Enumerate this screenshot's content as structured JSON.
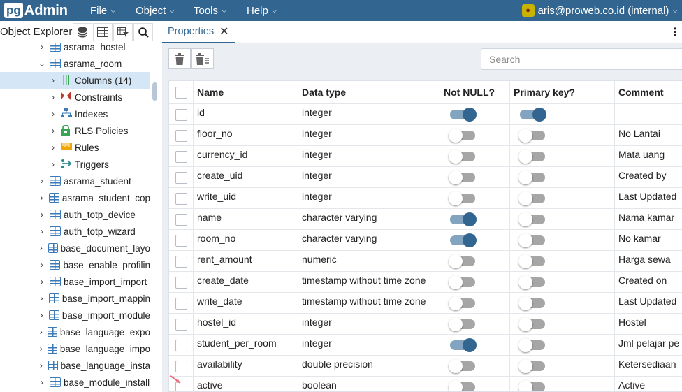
{
  "navbar": {
    "logo_pg": "pg",
    "logo_admin": "Admin",
    "menus": [
      "File",
      "Object",
      "Tools",
      "Help"
    ],
    "user": "aris@proweb.co.id (internal)",
    "bg_color": "#326690"
  },
  "object_explorer": {
    "title": "Object Explorer",
    "buttons": [
      "database-icon",
      "table-grid-icon",
      "filtered-rows-icon",
      "search-icon"
    ]
  },
  "tree": [
    {
      "label": "asrama_hostel",
      "arrow": "›",
      "icon": "table-icon",
      "level": 1
    },
    {
      "label": "asrama_room",
      "arrow": "⌄",
      "icon": "table-icon",
      "level": 1
    },
    {
      "label": "Columns",
      "count": "(14)",
      "arrow": "›",
      "icon": "columns-icon",
      "level": 2,
      "selected": true
    },
    {
      "label": "Constraints",
      "arrow": "›",
      "icon": "constraints-icon",
      "level": 2
    },
    {
      "label": "Indexes",
      "arrow": "›",
      "icon": "indexes-icon",
      "level": 2
    },
    {
      "label": "RLS Policies",
      "arrow": "›",
      "icon": "rls-lock-icon",
      "level": 2
    },
    {
      "label": "Rules",
      "arrow": "›",
      "icon": "rules-icon",
      "level": 2
    },
    {
      "label": "Triggers",
      "arrow": "›",
      "icon": "triggers-icon",
      "level": 2
    },
    {
      "label": "asrama_student",
      "arrow": "›",
      "icon": "table-icon",
      "level": 1
    },
    {
      "label": "asrama_student_cop",
      "arrow": "›",
      "icon": "table-icon",
      "level": 1
    },
    {
      "label": "auth_totp_device",
      "arrow": "›",
      "icon": "table-icon",
      "level": 1
    },
    {
      "label": "auth_totp_wizard",
      "arrow": "›",
      "icon": "table-icon",
      "level": 1
    },
    {
      "label": "base_document_layo",
      "arrow": "›",
      "icon": "table-icon",
      "level": 1
    },
    {
      "label": "base_enable_profilin",
      "arrow": "›",
      "icon": "table-icon",
      "level": 1
    },
    {
      "label": "base_import_import",
      "arrow": "›",
      "icon": "table-icon",
      "level": 1
    },
    {
      "label": "base_import_mappin",
      "arrow": "›",
      "icon": "table-icon",
      "level": 1
    },
    {
      "label": "base_import_module",
      "arrow": "›",
      "icon": "table-icon",
      "level": 1
    },
    {
      "label": "base_language_expo",
      "arrow": "›",
      "icon": "table-icon",
      "level": 1
    },
    {
      "label": "base_language_impo",
      "arrow": "›",
      "icon": "table-icon",
      "level": 1
    },
    {
      "label": "base_language_insta",
      "arrow": "›",
      "icon": "table-icon",
      "level": 1
    },
    {
      "label": "base_module_install",
      "arrow": "›",
      "icon": "table-icon",
      "level": 1
    }
  ],
  "tabs": {
    "properties_label": "Properties",
    "close": "✕",
    "more": "⋮"
  },
  "toolbar": {
    "delete_icon": "trash-icon",
    "delete_all_icon": "trash-list-icon",
    "search_placeholder": "Search"
  },
  "table": {
    "headers": {
      "name": "Name",
      "type": "Data type",
      "not_null": "Not NULL?",
      "pk": "Primary key?",
      "comment": "Comment"
    },
    "rows": [
      {
        "name": "id",
        "type": "integer",
        "not_null": true,
        "pk": true,
        "comment": ""
      },
      {
        "name": "floor_no",
        "type": "integer",
        "not_null": false,
        "pk": false,
        "comment": "No Lantai"
      },
      {
        "name": "currency_id",
        "type": "integer",
        "not_null": false,
        "pk": false,
        "comment": "Mata uang"
      },
      {
        "name": "create_uid",
        "type": "integer",
        "not_null": false,
        "pk": false,
        "comment": "Created by"
      },
      {
        "name": "write_uid",
        "type": "integer",
        "not_null": false,
        "pk": false,
        "comment": "Last Updated"
      },
      {
        "name": "name",
        "type": "character varying",
        "not_null": true,
        "pk": false,
        "comment": "Nama kamar"
      },
      {
        "name": "room_no",
        "type": "character varying",
        "not_null": true,
        "pk": false,
        "comment": "No kamar"
      },
      {
        "name": "rent_amount",
        "type": "numeric",
        "not_null": false,
        "pk": false,
        "comment": "Harga sewa"
      },
      {
        "name": "create_date",
        "type": "timestamp without time zone",
        "not_null": false,
        "pk": false,
        "comment": "Created on"
      },
      {
        "name": "write_date",
        "type": "timestamp without time zone",
        "not_null": false,
        "pk": false,
        "comment": "Last Updated"
      },
      {
        "name": "hostel_id",
        "type": "integer",
        "not_null": false,
        "pk": false,
        "comment": "Hostel"
      },
      {
        "name": "student_per_room",
        "type": "integer",
        "not_null": true,
        "pk": false,
        "comment": "Jml pelajar pe"
      },
      {
        "name": "availability",
        "type": "double precision",
        "not_null": false,
        "pk": false,
        "comment": "Ketersediaan"
      },
      {
        "name": "active",
        "type": "boolean",
        "not_null": false,
        "pk": false,
        "comment": "Active"
      }
    ]
  }
}
